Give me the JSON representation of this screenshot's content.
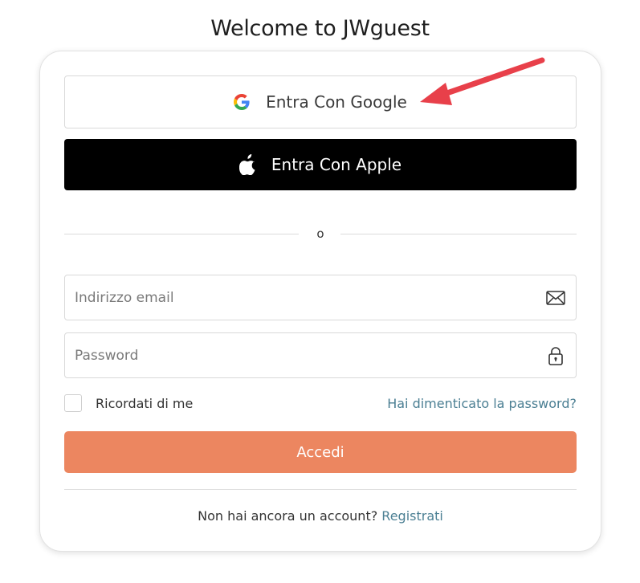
{
  "page": {
    "title": "Welcome to JWguest"
  },
  "social": {
    "google_label": "Entra Con Google",
    "google_icon": "google-g-icon",
    "apple_label": "Entra Con Apple",
    "apple_icon": "apple-logo-icon"
  },
  "divider": {
    "text": "o"
  },
  "form": {
    "email_placeholder": "Indirizzo email",
    "email_value": "",
    "email_icon": "envelope-icon",
    "password_placeholder": "Password",
    "password_value": "",
    "password_icon": "lock-icon",
    "remember_label": "Ricordati di me",
    "remember_checked": false,
    "forgot_label": "Hai dimenticato la password?",
    "submit_label": "Accedi"
  },
  "footer": {
    "prompt": "Non hai ancora un account?",
    "signup_label": "Registrati"
  },
  "annotation": {
    "arrow_color": "#e8404a",
    "arrow_icon": "annotation-arrow-icon"
  },
  "colors": {
    "accent": "#ec8660",
    "link": "#4b7f93",
    "apple_bg": "#000000"
  }
}
